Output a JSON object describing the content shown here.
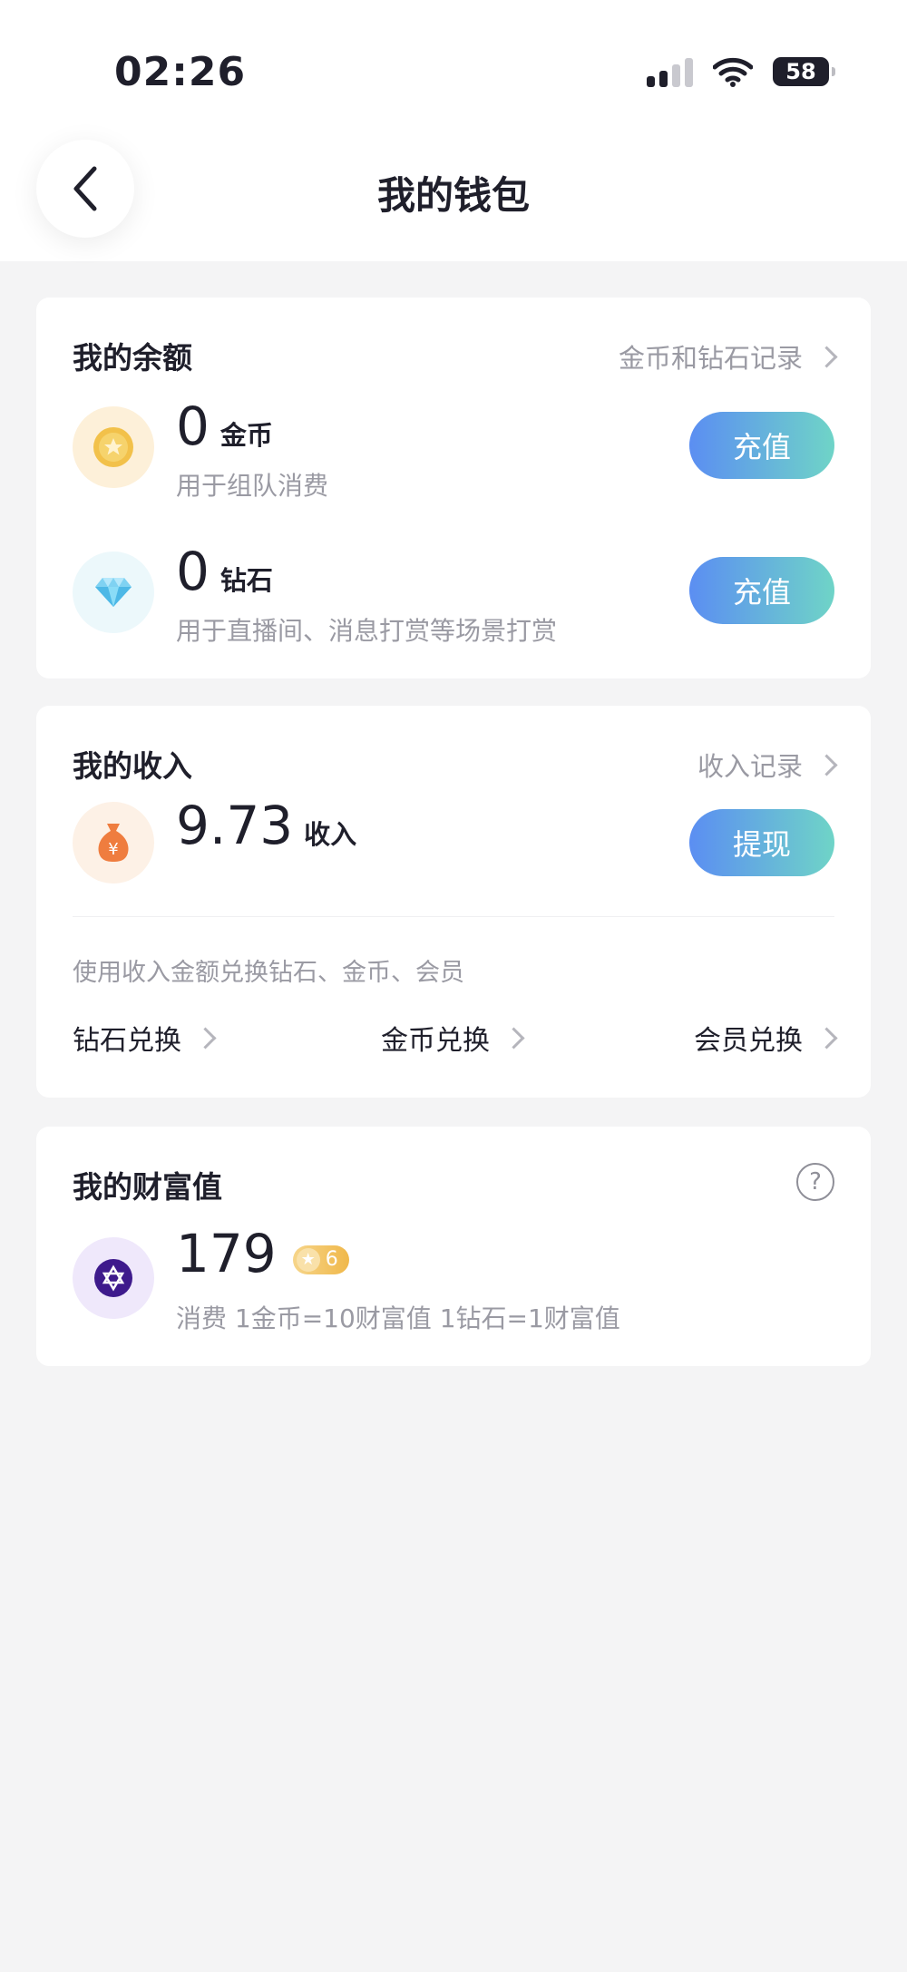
{
  "status_bar": {
    "time": "02:26",
    "battery": "58"
  },
  "header": {
    "title": "我的钱包"
  },
  "balance": {
    "title": "我的余额",
    "link": "金币和钻石记录",
    "coins": {
      "amount": "0",
      "unit": "金币",
      "desc": "用于组队消费",
      "button": "充值"
    },
    "diamonds": {
      "amount": "0",
      "unit": "钻石",
      "desc": "用于直播间、消息打赏等场景打赏",
      "button": "充值"
    }
  },
  "income": {
    "title": "我的收入",
    "link": "收入记录",
    "amount": "9.73",
    "unit": "收入",
    "button": "提现",
    "hint": "使用收入金额兑换钻石、金币、会员",
    "exchanges": [
      "钻石兑换",
      "金币兑换",
      "会员兑换"
    ]
  },
  "wealth": {
    "title": "我的财富值",
    "help": "?",
    "value": "179",
    "level": "6",
    "desc": "消费 1金币=10财富值 1钻石=1财富值"
  },
  "colors": {
    "accent_start": "#5b8ef2",
    "accent_end": "#6fd4c7"
  }
}
